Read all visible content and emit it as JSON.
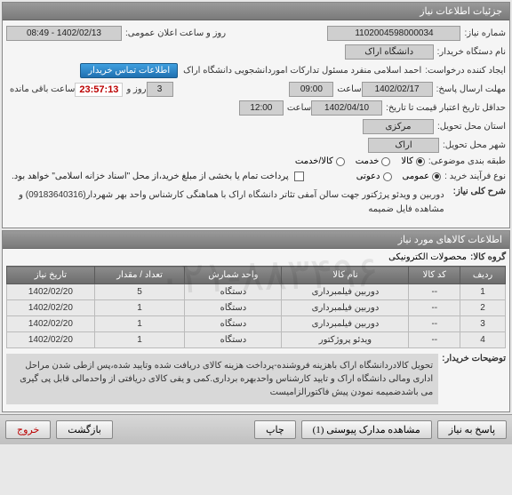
{
  "panel1": {
    "title": "جزئیات اطلاعات نیاز",
    "need_no_lbl": "شماره نیاز:",
    "need_no": "1102004598000034",
    "announce_lbl": "روز و ساعت اعلان عمومی:",
    "announce": "1402/02/13 - 08:49",
    "buyer_org_lbl": "نام دستگاه خریدار:",
    "buyer_org": "دانشگاه اراک",
    "requester_lbl": "ایجاد کننده درخواست:",
    "requester": "احمد  اسلامی منفرد مسئول تدارکات اموردانشجویی دانشگاه اراک",
    "contact_btn": "اطلاعات تماس خریدار",
    "deadline_lbl": "مهلت ارسال پاسخ:",
    "deadline_date": "1402/02/17",
    "time_lbl": "ساعت",
    "deadline_time": "09:00",
    "day_lbl": "روز و",
    "days_left": "3",
    "countdown": "23:57:13",
    "remain_lbl": "ساعت باقی مانده",
    "validity_lbl": "حداقل تاریخ اعتبار قیمت تا تاریخ:",
    "validity_date": "1402/04/10",
    "validity_time": "12:00",
    "province_lbl": "استان محل تحویل:",
    "province": "مرکزی",
    "city_lbl": "شهر محل تحویل:",
    "city": "اراک",
    "category_lbl": "طبقه بندی موضوعی:",
    "cat_goods": "کالا",
    "cat_service": "خدمت",
    "cat_goods_service": "کالا/خدمت",
    "process_lbl": "نوع فرآیند خرید :",
    "proc_public": "عمومی",
    "proc_invite": "دعوتی",
    "pay_note": "پرداخت تمام یا بخشی از مبلغ خرید،از محل \"اسناد خزانه اسلامی\" خواهد بود.",
    "summary_lbl": "شرح کلی نیاز:",
    "summary": "دوربین و ویدئو پرژکتور جهت سالن آمفی تئاتر دانشگاه اراک با هماهنگی کارشناس واحد بهر شهردار(09183640316) و مشاهده فایل ضمیمه"
  },
  "panel2": {
    "title": "اطلاعات کالاهای مورد نیاز",
    "group_lbl": "گروه کالا:",
    "group": "محصولات الکترونیکی",
    "headers": {
      "row": "ردیف",
      "code": "کد کالا",
      "name": "نام کالا",
      "unit": "واحد شمارش",
      "qty": "تعداد / مقدار",
      "date": "تاریخ نیاز"
    },
    "rows": [
      {
        "r": "1",
        "code": "--",
        "name": "دوربین فیلمبرداری",
        "unit": "دستگاه",
        "qty": "5",
        "date": "1402/02/20"
      },
      {
        "r": "2",
        "code": "--",
        "name": "دوربین فیلمبرداری",
        "unit": "دستگاه",
        "qty": "1",
        "date": "1402/02/20"
      },
      {
        "r": "3",
        "code": "--",
        "name": "دوربین فیلمبرداری",
        "unit": "دستگاه",
        "qty": "1",
        "date": "1402/02/20"
      },
      {
        "r": "4",
        "code": "--",
        "name": "ویدئو پروژکتور",
        "unit": "دستگاه",
        "qty": "1",
        "date": "1402/02/20"
      }
    ],
    "buyer_note_lbl": "توضیحات خریدار:",
    "buyer_note": "تحویل کالادردانشگاه اراک باهزینه فروشنده-پرداخت هزینه کالای دریافت شده وتایید شده،پس ازطی شدن مراحل اداری ومالی دانشگاه اراک و تایید کارشناس واحدبهره برداری.کمی و یفی کالای دریافتی از واحدمالی قابل پی گیری می باشدضمیمه نمودن پیش فاکتورالزامیست"
  },
  "footer": {
    "respond": "پاسخ به نیاز",
    "attachments": "مشاهده مدارک پیوستی (1)",
    "print": "چاپ",
    "back": "بازگشت",
    "exit": "خروج"
  }
}
